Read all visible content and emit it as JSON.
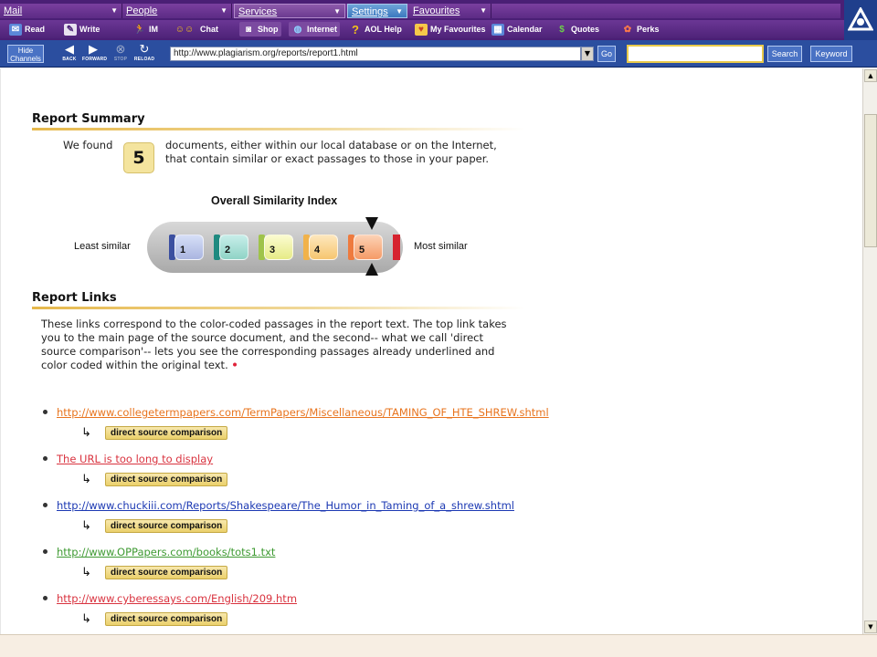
{
  "aol": {
    "menus": [
      {
        "label": "Mail"
      },
      {
        "label": "People"
      },
      {
        "label": "Services"
      },
      {
        "label": "Settings"
      },
      {
        "label": "Favourites"
      }
    ],
    "toolbar": [
      {
        "label": "Read",
        "icon": "mail-read-icon"
      },
      {
        "label": "Write",
        "icon": "write-mail-icon"
      },
      {
        "label": "IM",
        "icon": "instant-message-icon"
      },
      {
        "label": "Chat",
        "icon": "chat-icon"
      },
      {
        "label": "Shop",
        "icon": "shop-icon"
      },
      {
        "label": "Internet",
        "icon": "internet-globe-icon"
      },
      {
        "label": "AOL Help",
        "icon": "help-icon"
      },
      {
        "label": "My Favourites",
        "icon": "heart-icon"
      },
      {
        "label": "Calendar",
        "icon": "calendar-icon"
      },
      {
        "label": "Quotes",
        "icon": "dollar-icon"
      },
      {
        "label": "Perks",
        "icon": "gift-icon"
      }
    ]
  },
  "nav": {
    "hide_channels": "Hide Channels",
    "back": "BACK",
    "forward": "FORWARD",
    "stop": "STOP",
    "reload": "RELOAD",
    "url": "http://www.plagiarism.org/reports/report1.html",
    "go": "Go",
    "search_value": "",
    "search_button": "Search",
    "keyword_button": "Keyword"
  },
  "summary": {
    "heading": "Report Summary",
    "found_prefix": "We found",
    "count": "5",
    "found_text": "documents, either within our local database or on the Internet, that contain similar or exact passages to those in your paper.",
    "osi_title": "Overall Similarity Index",
    "least_label": "Least similar",
    "most_label": "Most similar",
    "cells": [
      "1",
      "2",
      "3",
      "4",
      "5"
    ],
    "selected_level": 5,
    "cell_colors": [
      "#3b4fa0",
      "#1f8a80",
      "#9fc34a",
      "#f1b24a",
      "#ee7a3e"
    ]
  },
  "links": {
    "heading": "Report Links",
    "intro": "These links correspond to the color-coded passages in the report text. The top link takes you to the main page of the source document, and the second-- what we call 'direct source comparison'-- lets you see the corresponding passages already underlined and color coded within the original text.",
    "intro_mark": "•",
    "dsc_label": "direct source comparison",
    "items": [
      {
        "url": "http://www.collegetermpapers.com/TermPapers/Miscellaneous/TAMING_OF_HTE_SHREW.shtml",
        "color": "#e8741e"
      },
      {
        "url": "The URL is too long to display",
        "color": "#d9333f"
      },
      {
        "url": "http://www.chuckiii.com/Reports/Shakespeare/The_Humor_in_Taming_of_a_shrew.shtml",
        "color": "#1c39b3"
      },
      {
        "url": "http://www.OPPapers.com/books/tots1.txt",
        "color": "#3e9a32"
      },
      {
        "url": "http://www.cyberessays.com/English/209.htm",
        "color": "#d9333f"
      }
    ]
  }
}
